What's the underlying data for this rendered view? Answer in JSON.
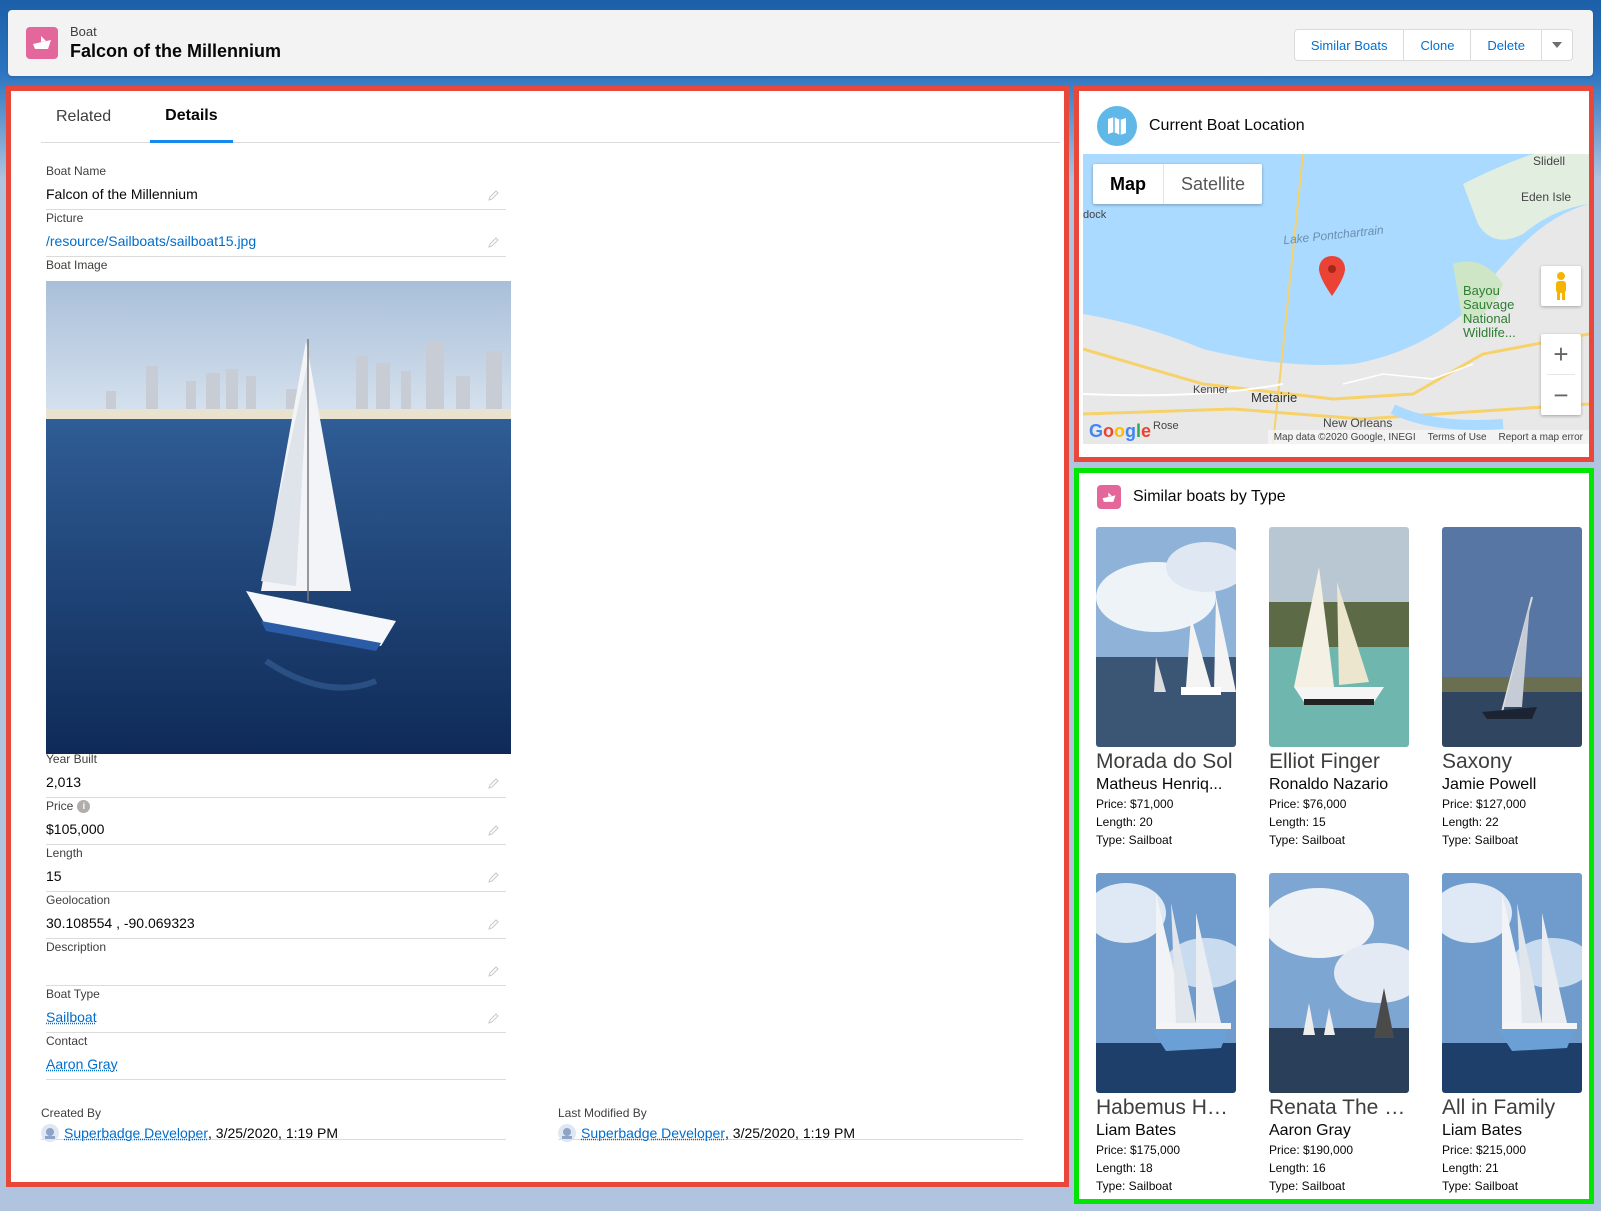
{
  "colors": {
    "brand_blue": "#0070d2",
    "boat_icon": "#e3679b",
    "map_icon": "#5fb8e8",
    "highlight_red": "#e8473a",
    "highlight_green": "#00e600"
  },
  "header": {
    "object_type": "Boat",
    "record_name": "Falcon of the Millennium",
    "icon": "boat-icon",
    "actions": [
      {
        "label": "Similar Boats"
      },
      {
        "label": "Clone"
      },
      {
        "label": "Delete"
      }
    ],
    "menu_icon": "chevron-down-icon"
  },
  "tabs": [
    {
      "label": "Related",
      "active": false
    },
    {
      "label": "Details",
      "active": true
    }
  ],
  "fields": {
    "boat_name": {
      "label": "Boat Name",
      "value": "Falcon of the Millennium"
    },
    "picture": {
      "label": "Picture",
      "value": "/resource/Sailboats/sailboat15.jpg"
    },
    "boat_image": {
      "label": "Boat Image"
    },
    "year_built": {
      "label": "Year Built",
      "value": "2,013"
    },
    "price": {
      "label": "Price",
      "value": "$105,000"
    },
    "length": {
      "label": "Length",
      "value": "15"
    },
    "geolocation": {
      "label": "Geolocation",
      "value": "30.108554 , -90.069323"
    },
    "description": {
      "label": "Description",
      "value": ""
    },
    "boat_type": {
      "label": "Boat Type",
      "value": "Sailboat"
    },
    "contact": {
      "label": "Contact",
      "value": "Aaron Gray"
    },
    "created_by": {
      "label": "Created By",
      "user": "Superbadge Developer",
      "date": ", 3/25/2020, 1:19 PM"
    },
    "last_modified_by": {
      "label": "Last Modified By",
      "user": "Superbadge Developer",
      "date": ", 3/25/2020, 1:19 PM"
    }
  },
  "map_card": {
    "title": "Current Boat Location",
    "icon": "map-icon",
    "toggle": [
      {
        "label": "Map",
        "active": true
      },
      {
        "label": "Satellite",
        "active": false
      }
    ],
    "places": {
      "slidell": "Slidell",
      "eden_isle": "Eden Isle",
      "lake": "Lake Pontchartrain",
      "bayou": "Bayou",
      "bayou2": "Sauvage",
      "bayou3": "National",
      "bayou4": "Wildlife...",
      "kenner": "Kenner",
      "metairie": "Metairie",
      "rose": "Rose",
      "new_orleans": "New Orleans",
      "dock": "dock"
    },
    "attribution": [
      "Map data ©2020 Google, INEGI",
      "Terms of Use",
      "Report a map error"
    ],
    "google_logo": "Google",
    "zoom_in": "+",
    "zoom_out": "−"
  },
  "similar": {
    "title": "Similar boats by Type",
    "icon": "boat-icon",
    "boats": [
      {
        "name": "Morada do Sol",
        "owner": "Matheus Henriq...",
        "price": "Price: $71,000",
        "length": "Length: 20",
        "type": "Type: Sailboat"
      },
      {
        "name": "Elliot Finger",
        "owner": "Ronaldo Nazario",
        "price": "Price: $76,000",
        "length": "Length: 15",
        "type": "Type: Sailboat"
      },
      {
        "name": "Saxony",
        "owner": "Jamie Powell",
        "price": "Price: $127,000",
        "length": "Length: 22",
        "type": "Type: Sailboat"
      },
      {
        "name": "Habemus He...",
        "owner": "Liam Bates",
        "price": "Price: $175,000",
        "length": "Length: 18",
        "type": "Type: Sailboat"
      },
      {
        "name": "Renata The E...",
        "owner": "Aaron Gray",
        "price": "Price: $190,000",
        "length": "Length: 16",
        "type": "Type: Sailboat"
      },
      {
        "name": "All in Family",
        "owner": "Liam Bates",
        "price": "Price: $215,000",
        "length": "Length: 21",
        "type": "Type: Sailboat"
      }
    ]
  }
}
